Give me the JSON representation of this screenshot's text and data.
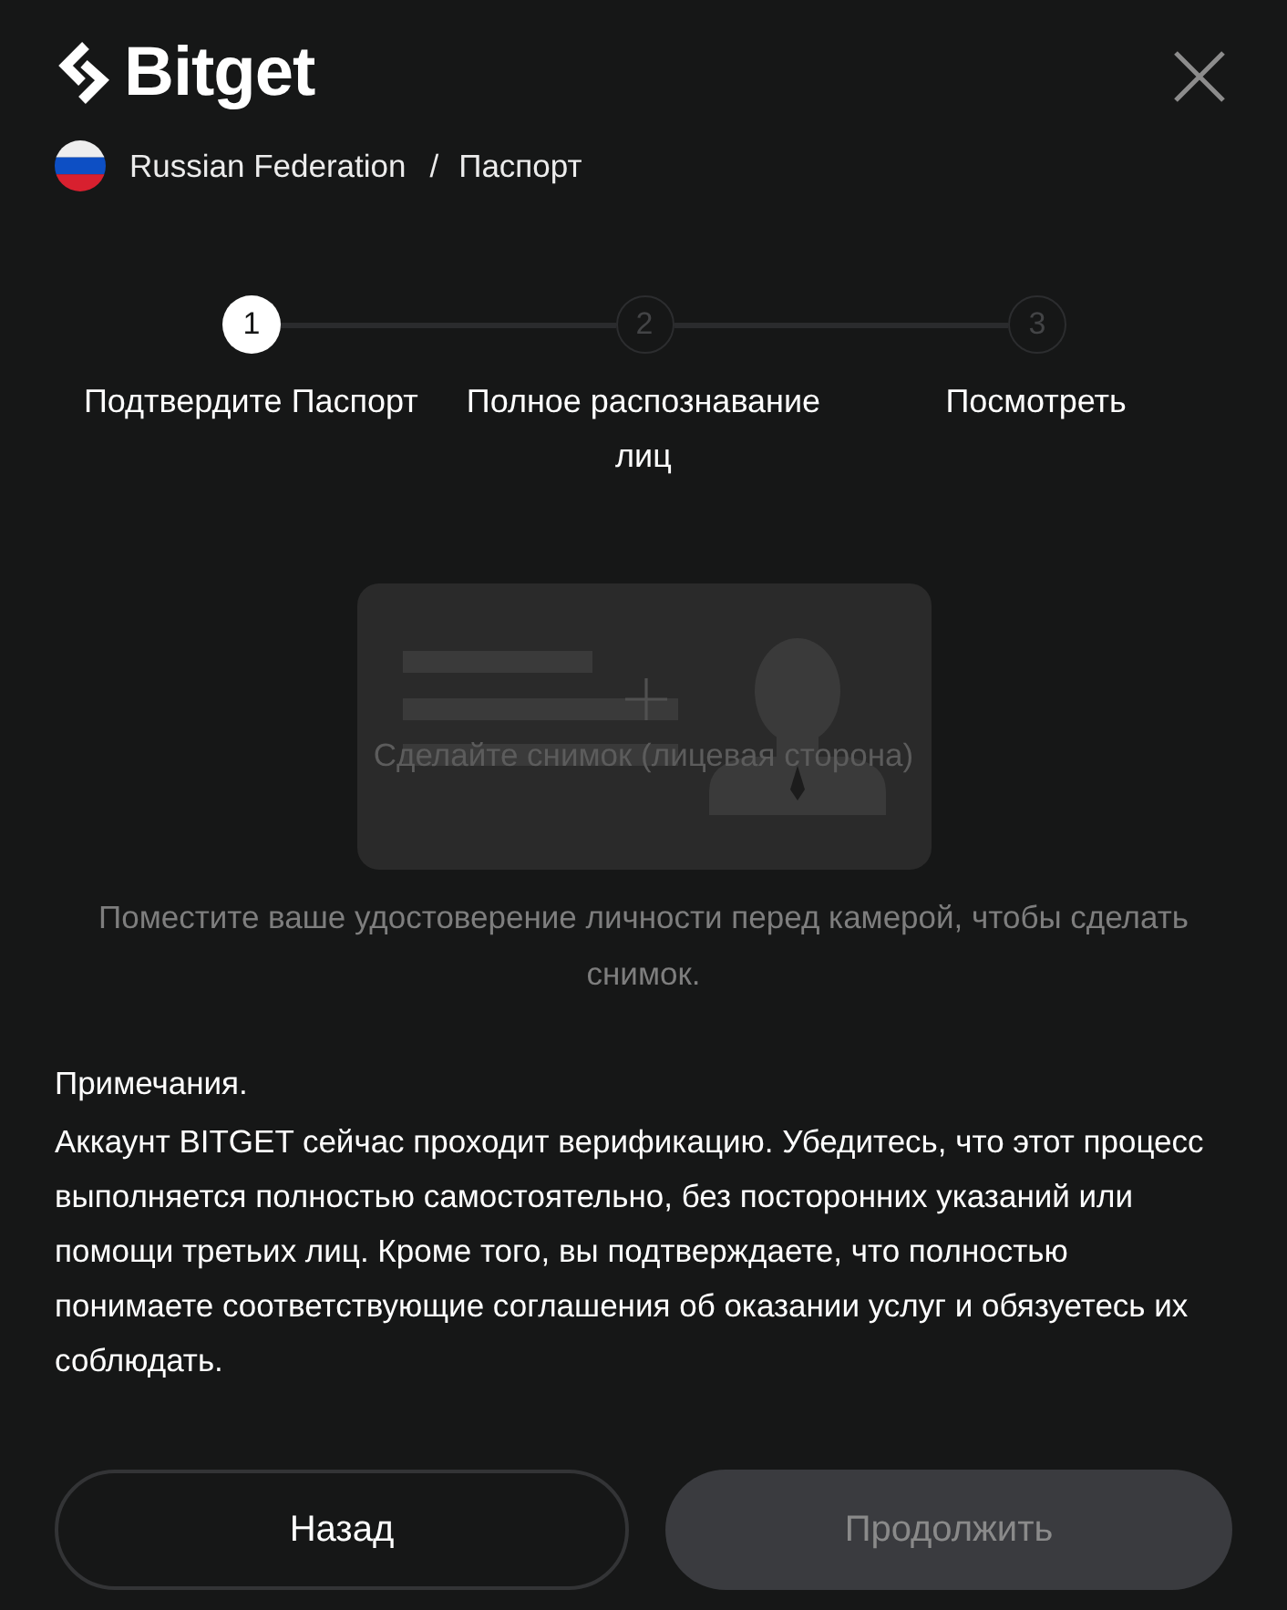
{
  "logo": {
    "text": "Bitget"
  },
  "breadcrumb": {
    "country": "Russian Federation",
    "separator": "/",
    "document": "Паспорт"
  },
  "steps": [
    {
      "number": "1",
      "label": "Подтвердите Паспорт",
      "selected": true
    },
    {
      "number": "2",
      "label": "Полное распознавание лиц",
      "selected": false
    },
    {
      "number": "3",
      "label": "Посмотреть",
      "selected": false
    }
  ],
  "upload": {
    "label": "Сделайте снимок (лицевая сторона)"
  },
  "hint": "Поместите ваше удостоверение личности перед камерой, чтобы сделать снимок.",
  "notes": {
    "title": "Примечания.",
    "body": "Аккаунт BITGET сейчас проходит верификацию. Убедитесь, что этот процесс выполняется полностью самостоятельно, без посторонних указаний или помощи третьих лиц. Кроме того, вы подтверждаете, что полностью понимаете соответствующие соглашения об оказании услуг и обязуетесь их соблюдать."
  },
  "buttons": [
    {
      "label": "Назад",
      "kind": "secondary",
      "disabled": false
    },
    {
      "label": "Продолжить",
      "kind": "primary",
      "disabled": true
    }
  ]
}
